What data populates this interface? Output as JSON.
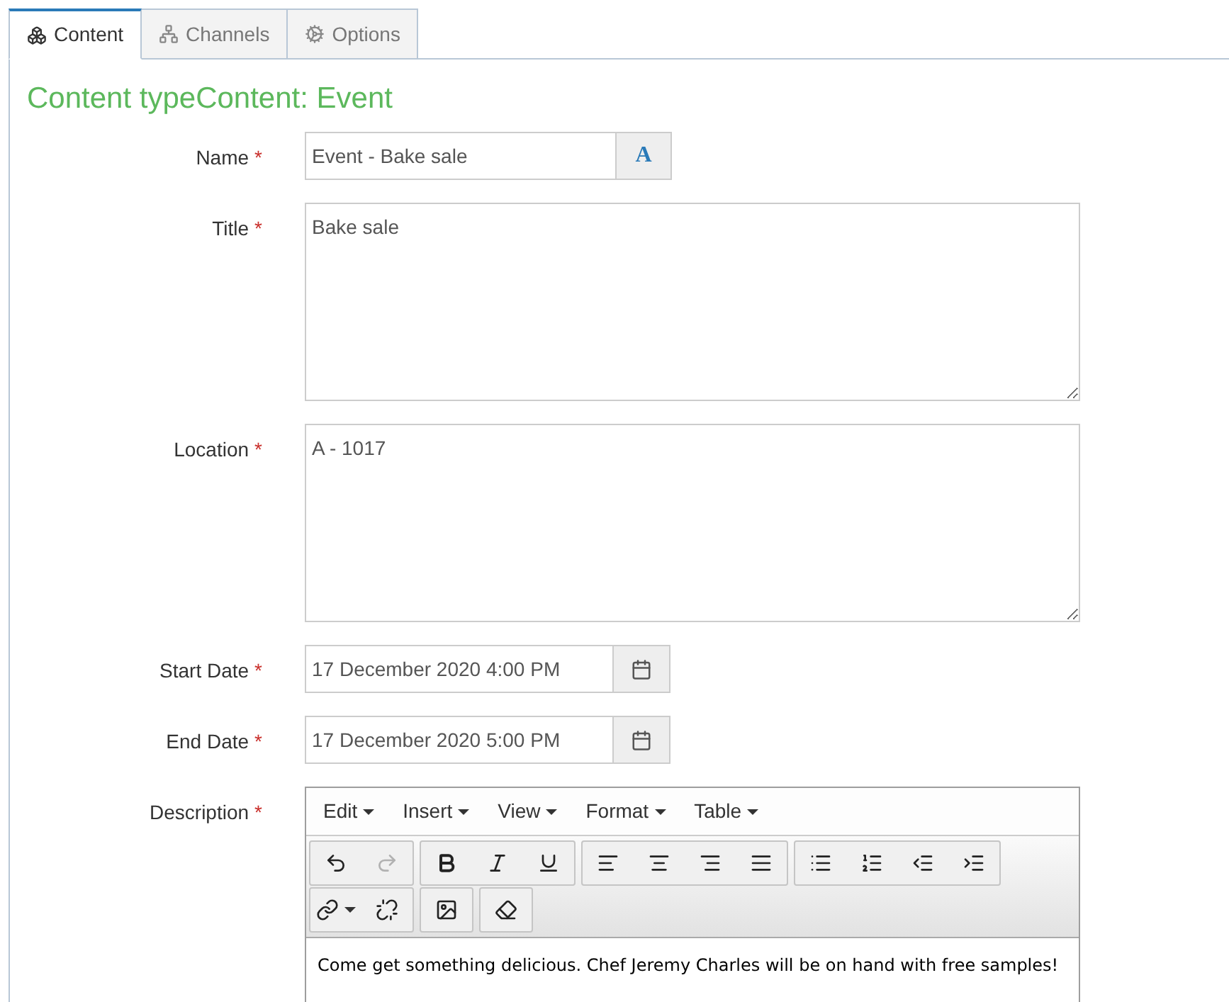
{
  "tabs": [
    {
      "label": "Content",
      "selected": true
    },
    {
      "label": "Channels",
      "selected": false
    },
    {
      "label": "Options",
      "selected": false
    }
  ],
  "heading": "Content typeContent: Event",
  "fields": [
    {
      "kind": "text",
      "label": "Name",
      "required_mark": "*",
      "value": "Event - Bake sale",
      "button": "A"
    },
    {
      "kind": "textarea",
      "label": "Title",
      "required_mark": "*",
      "value": "Bake sale"
    },
    {
      "kind": "textarea",
      "label": "Location",
      "required_mark": "*",
      "value": "A - 1017"
    },
    {
      "kind": "date",
      "label": "Start Date",
      "required_mark": "*",
      "value": "17 December 2020 4:00 PM"
    },
    {
      "kind": "date",
      "label": "End Date",
      "required_mark": "*",
      "value": "17 December 2020 5:00 PM"
    },
    {
      "kind": "editor",
      "label": "Description",
      "required_mark": "*",
      "menus": [
        "Edit",
        "Insert",
        "View",
        "Format",
        "Table"
      ],
      "toolbar_rows": [
        [
          [
            {
              "kind": "undo",
              "disabled": false
            },
            {
              "kind": "redo",
              "disabled": true
            }
          ],
          [
            {
              "kind": "bold",
              "disabled": false
            },
            {
              "kind": "italic",
              "disabled": false
            },
            {
              "kind": "underline",
              "disabled": false
            }
          ],
          [
            {
              "kind": "align-left",
              "disabled": false
            },
            {
              "kind": "align-center",
              "disabled": false
            },
            {
              "kind": "align-right",
              "disabled": false
            },
            {
              "kind": "justify",
              "disabled": false
            }
          ],
          [
            {
              "kind": "bullet-list",
              "disabled": false
            },
            {
              "kind": "numbered-list",
              "disabled": false
            },
            {
              "kind": "outdent",
              "disabled": false
            },
            {
              "kind": "indent",
              "disabled": false
            }
          ]
        ],
        [
          [
            {
              "kind": "link",
              "disabled": false
            },
            {
              "kind": "unlink",
              "disabled": false
            }
          ],
          [
            {
              "kind": "image",
              "disabled": false
            }
          ],
          [
            {
              "kind": "eraser",
              "disabled": false
            }
          ]
        ]
      ],
      "value": "Come get something delicious. Chef Jeremy Charles will be on hand with free samples!"
    }
  ]
}
